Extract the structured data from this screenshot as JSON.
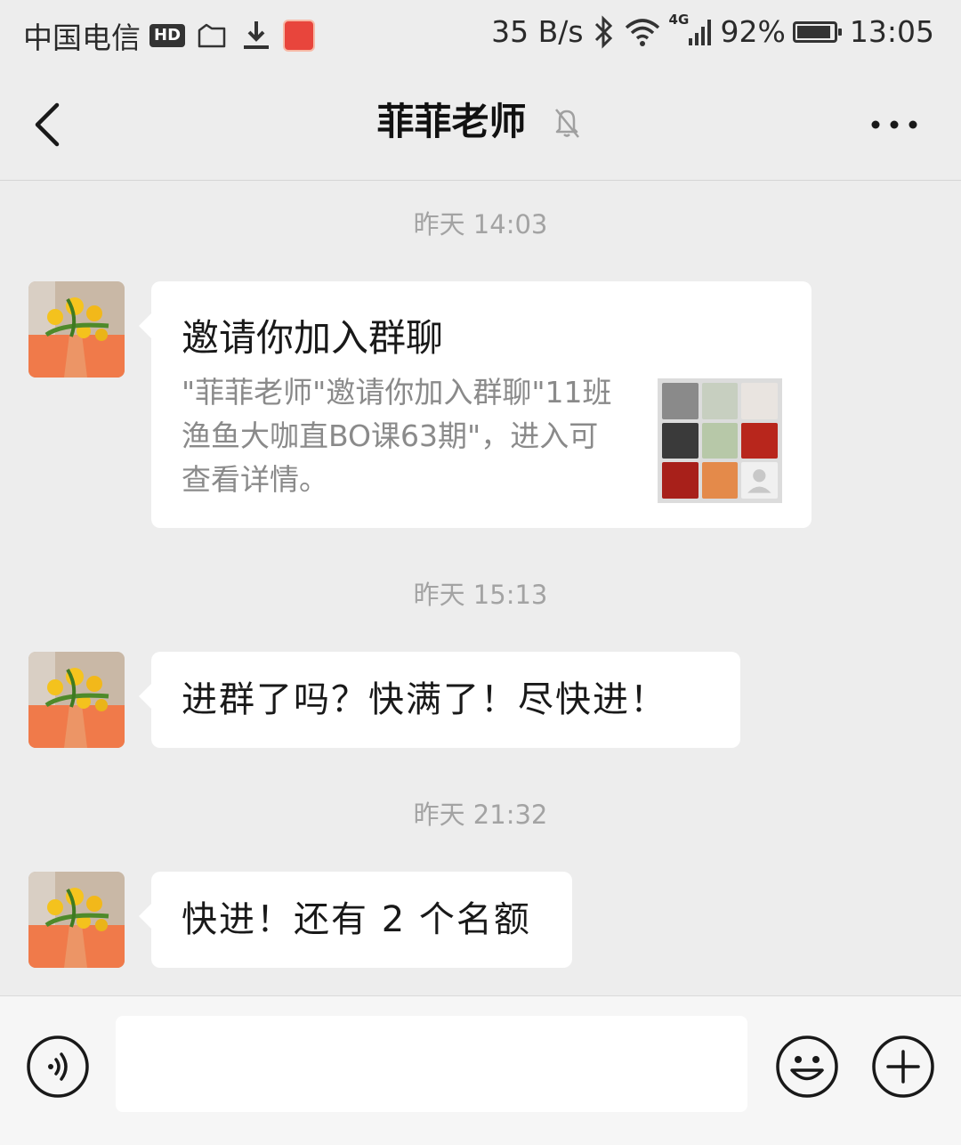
{
  "status_bar": {
    "carrier": "中国电信",
    "hd": "HD",
    "net_speed": "35 B/s",
    "signal_label": "4G",
    "battery": "92%",
    "battery_level": 0.92,
    "time": "13:05"
  },
  "header": {
    "title": "菲菲老师",
    "back_icon": "chevron-left-icon",
    "mute_icon": "bell-off-icon",
    "more_icon": "more-dots-icon"
  },
  "messages": [
    {
      "timestamp": "昨天 14:03",
      "type": "group_invite",
      "title": "邀请你加入群聊",
      "description": "\"菲菲老师\"邀请你加入群聊\"11班渔鱼大咖直BO课63期\"，进入可查看详情。"
    },
    {
      "timestamp": "昨天 15:13",
      "type": "text",
      "text": "进群了吗？快满了！尽快进！"
    },
    {
      "timestamp": "昨天 21:32",
      "type": "text",
      "text": "快进！还有 2 个名额"
    }
  ],
  "input_bar": {
    "voice_icon": "voice-icon",
    "emoji_icon": "emoji-icon",
    "plus_icon": "plus-icon",
    "input_value": ""
  },
  "colors": {
    "background": "#ededed",
    "bubble": "#ffffff",
    "timestamp": "#a3a3a3",
    "secondary_text": "#8a8a8a"
  }
}
